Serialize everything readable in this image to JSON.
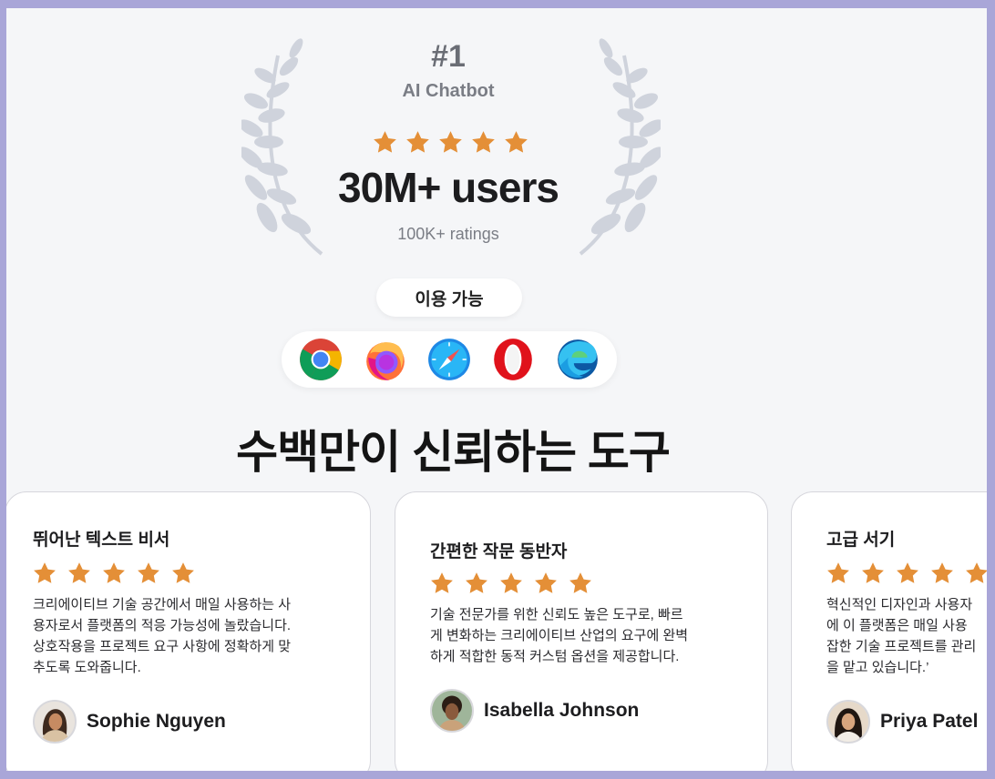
{
  "badge": {
    "rank": "#1",
    "category": "AI Chatbot",
    "star_count": 5,
    "users": "30M+ users",
    "ratings": "100K+ ratings"
  },
  "availability": {
    "label": "이용 가능",
    "browsers": [
      "chrome-icon",
      "firefox-icon",
      "safari-icon",
      "opera-icon",
      "edge-icon"
    ]
  },
  "headline": "수백만이 신뢰하는 도구",
  "colors": {
    "star": "#e48f37",
    "background": "#f5f6f8",
    "frame": "#a9a6d8"
  },
  "reviews": [
    {
      "title": "뛰어난 텍스트 비서",
      "stars": 5,
      "lines": [
        "크리에이티브 기술 공간에서 매일 사용하는 사",
        "용자로서 플랫폼의 적응 가능성에 놀랐습니다.",
        "상호작용을 프로젝트 요구 사항에 정확하게 맞",
        "추도록 도와줍니다."
      ],
      "author": "Sophie Nguyen"
    },
    {
      "title": "간편한 작문 동반자",
      "stars": 5,
      "lines": [
        "기술 전문가를 위한 신뢰도 높은 도구로, 빠르",
        "게 변화하는 크리에이티브 산업의 요구에 완벽",
        "하게 적합한 동적 커스텀 옵션을 제공합니다."
      ],
      "author": "Isabella Johnson"
    },
    {
      "title": "고급 서기",
      "stars": 5,
      "lines": [
        "혁신적인 디자인과 사용자",
        "에 이 플랫폼은 매일 사용",
        "잡한 기술 프로젝트를 관리",
        "을 맡고 있습니다.’"
      ],
      "author": "Priya Patel"
    }
  ]
}
